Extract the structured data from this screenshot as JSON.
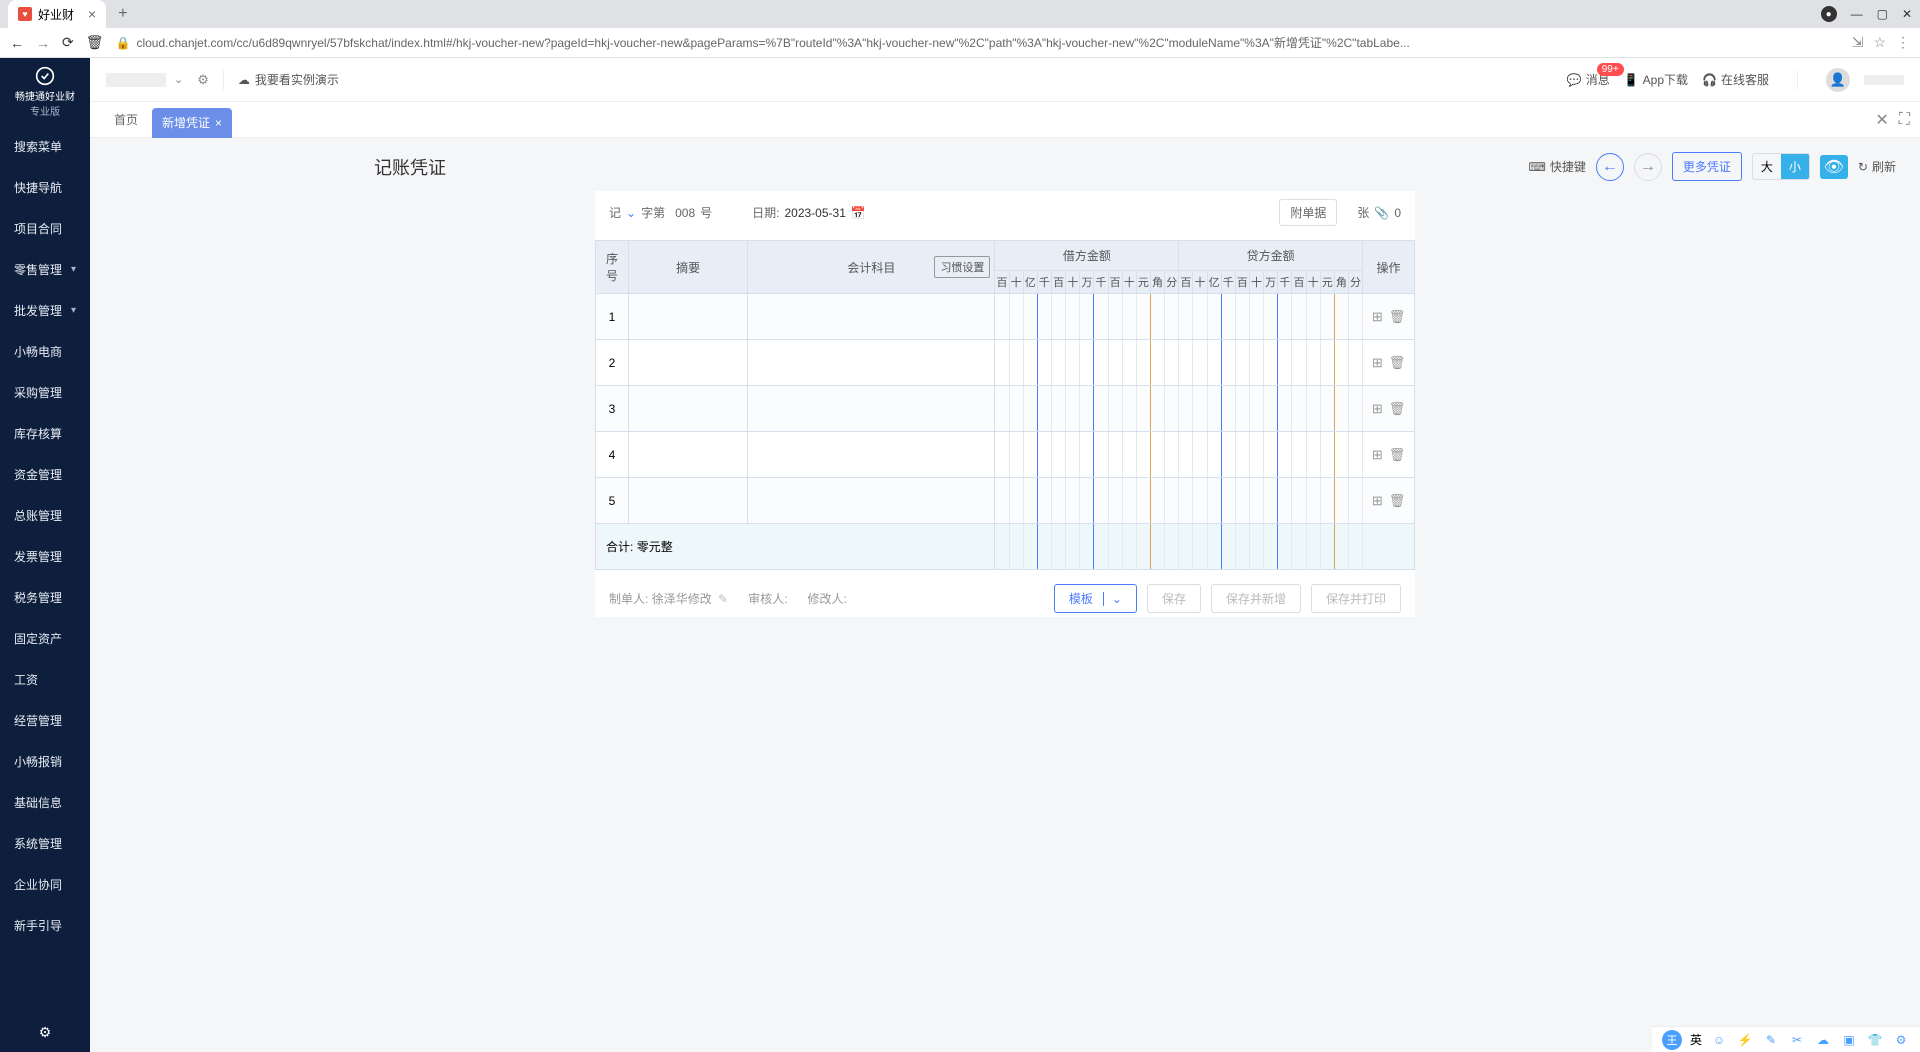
{
  "browser": {
    "tab_title": "好业财",
    "url": "cloud.chanjet.com/cc/u6d89qwnryel/57bfskchat/index.html#/hkj-voucher-new?pageId=hkj-voucher-new&pageParams=%7B\"routeId\"%3A\"hkj-voucher-new\"%2C\"path\"%3A\"hkj-voucher-new\"%2C\"moduleName\"%3A\"新增凭证\"%2C\"tabLabe..."
  },
  "sidebar": {
    "logo_text": "畅捷通好业财",
    "logo_sub": "专业版",
    "items": [
      {
        "label": "搜索菜单",
        "has_sub": false
      },
      {
        "label": "快捷导航",
        "has_sub": false
      },
      {
        "label": "项目合同",
        "has_sub": false
      },
      {
        "label": "零售管理",
        "has_sub": true
      },
      {
        "label": "批发管理",
        "has_sub": true
      },
      {
        "label": "小畅电商",
        "has_sub": false
      },
      {
        "label": "采购管理",
        "has_sub": false
      },
      {
        "label": "库存核算",
        "has_sub": false
      },
      {
        "label": "资金管理",
        "has_sub": false
      },
      {
        "label": "总账管理",
        "has_sub": false
      },
      {
        "label": "发票管理",
        "has_sub": false
      },
      {
        "label": "税务管理",
        "has_sub": false
      },
      {
        "label": "固定资产",
        "has_sub": false
      },
      {
        "label": "工资",
        "has_sub": false
      },
      {
        "label": "经营管理",
        "has_sub": false
      },
      {
        "label": "小畅报销",
        "has_sub": false
      },
      {
        "label": "基础信息",
        "has_sub": false
      },
      {
        "label": "系统管理",
        "has_sub": false
      },
      {
        "label": "企业协同",
        "has_sub": false
      },
      {
        "label": "新手引导",
        "has_sub": false
      }
    ]
  },
  "header": {
    "demo_link": "我要看实例演示",
    "msg_label": "消息",
    "msg_badge": "99+",
    "app_download": "App下载",
    "online_service": "在线客服"
  },
  "tabs": {
    "home": "首页",
    "active": "新增凭证"
  },
  "voucher": {
    "title": "记账凭证",
    "shortcut": "快捷键",
    "more": "更多凭证",
    "size_large": "大",
    "size_small": "小",
    "refresh": "刷新",
    "prefix": "记",
    "prefix_suffix": "字第",
    "number": "008",
    "number_suffix": "号",
    "date_label": "日期:",
    "date": "2023-05-31",
    "attach_btn": "附单据",
    "sheets_label": "张",
    "attach_count": "0",
    "headers": {
      "seq": "序号",
      "summary": "摘要",
      "subject": "会计科目",
      "habit": "习惯设置",
      "debit": "借方金额",
      "credit": "贷方金额",
      "ops": "操作"
    },
    "digits": [
      "百",
      "十",
      "亿",
      "千",
      "百",
      "十",
      "万",
      "千",
      "百",
      "十",
      "元",
      "角",
      "分"
    ],
    "rows": [
      1,
      2,
      3,
      4,
      5
    ],
    "total_label": "合计:",
    "total_text": "零元整",
    "footer": {
      "maker_label": "制单人:",
      "maker": "徐泽华修改",
      "auditor_label": "审核人:",
      "modifier_label": "修改人:",
      "template": "模板",
      "save": "保存",
      "save_new": "保存并新增",
      "save_print": "保存并打印"
    }
  },
  "taskbar": {
    "ime": "英"
  }
}
